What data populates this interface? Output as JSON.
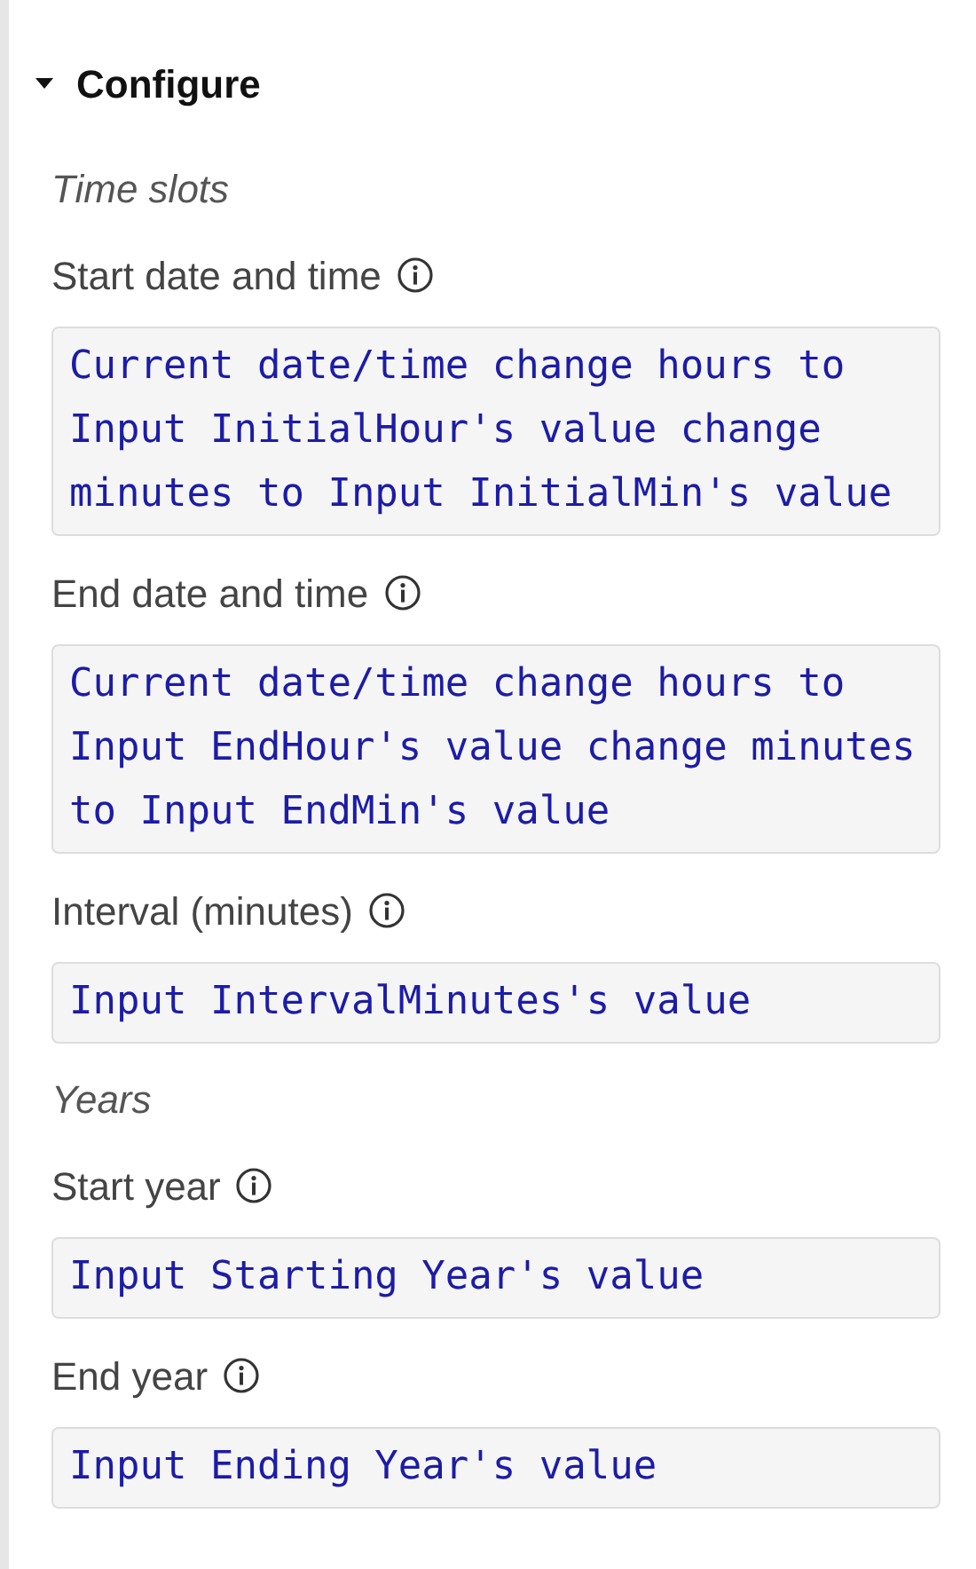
{
  "section": {
    "title": "Configure",
    "expanded": true,
    "groups": [
      {
        "heading": "Time slots",
        "fields": [
          {
            "label": "Start date and time",
            "value": "Current date/time change hours to Input InitialHour's value change minutes to Input InitialMin's value"
          },
          {
            "label": "End date and time",
            "value": "Current date/time change hours to Input EndHour's value change minutes to Input EndMin's value"
          },
          {
            "label": "Interval (minutes)",
            "value": "Input IntervalMinutes's value"
          }
        ]
      },
      {
        "heading": "Years",
        "fields": [
          {
            "label": "Start year",
            "value": "Input Starting Year's value"
          },
          {
            "label": "End year",
            "value": "Input Ending Year's value"
          }
        ]
      }
    ]
  }
}
